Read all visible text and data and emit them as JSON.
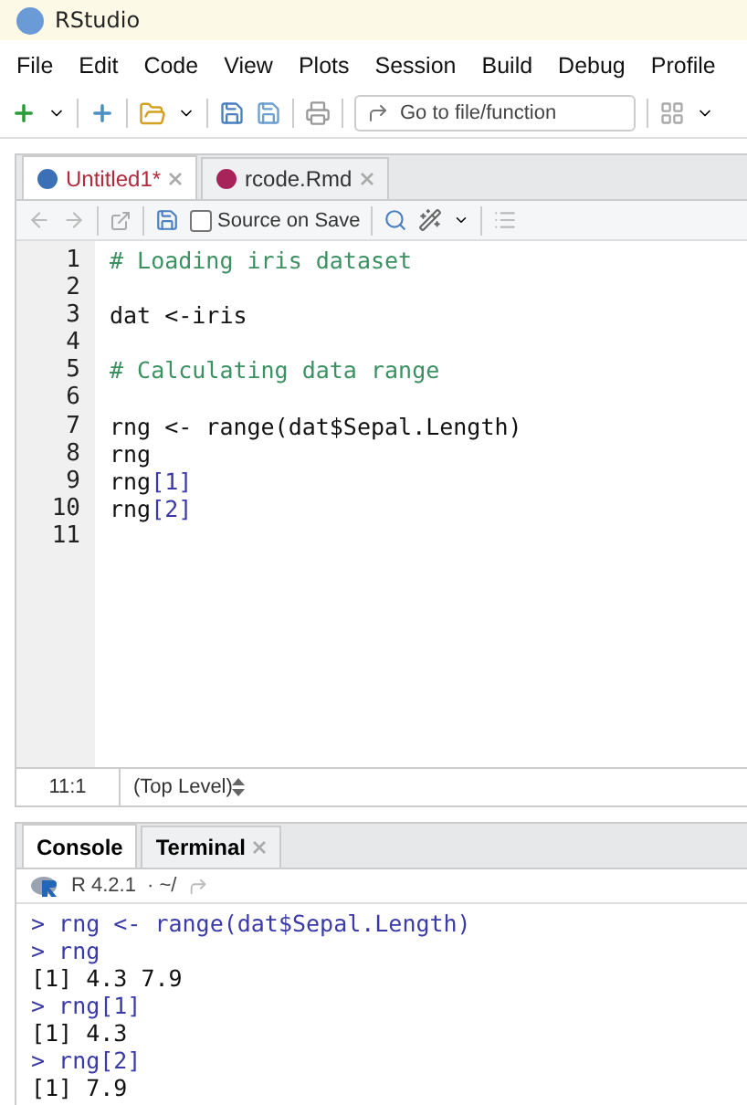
{
  "window": {
    "title": "RStudio"
  },
  "menu": [
    "File",
    "Edit",
    "Code",
    "View",
    "Plots",
    "Session",
    "Build",
    "Debug",
    "Profile"
  ],
  "toolbar": {
    "goto_placeholder": "Go to file/function"
  },
  "editor_tabs": [
    {
      "label": "Untitled1*",
      "kind": "r",
      "selected": true,
      "modified": true
    },
    {
      "label": "rcode.Rmd",
      "kind": "rmd",
      "selected": false,
      "modified": false
    }
  ],
  "editor_toolbar": {
    "source_on_save": {
      "label": "Source on Save",
      "checked": false
    }
  },
  "code_lines": [
    {
      "number": "1",
      "segments": [
        {
          "kind": "comment",
          "text": "# Loading iris dataset"
        }
      ]
    },
    {
      "number": "2"
    },
    {
      "number": "3",
      "segments": [
        {
          "kind": "plain",
          "text": "dat <-iris"
        }
      ]
    },
    {
      "number": "4"
    },
    {
      "number": "5",
      "segments": [
        {
          "kind": "comment",
          "text": "# Calculating data range"
        }
      ]
    },
    {
      "number": "6"
    },
    {
      "number": "7",
      "segments": [
        {
          "kind": "plain",
          "text": "rng <- range(dat$Sepal.Length)"
        }
      ]
    },
    {
      "number": "8",
      "segments": [
        {
          "kind": "plain",
          "text": "rng"
        }
      ]
    },
    {
      "number": "9",
      "segments": [
        {
          "kind": "plain",
          "text": "rng"
        },
        {
          "kind": "number",
          "text": "[1]"
        }
      ]
    },
    {
      "number": "10",
      "segments": [
        {
          "kind": "plain",
          "text": "rng"
        },
        {
          "kind": "number",
          "text": "[2]"
        }
      ]
    },
    {
      "number": "11"
    }
  ],
  "status_bar": {
    "position": "11:1",
    "scope": "(Top Level)"
  },
  "console_tabs": [
    {
      "label": "Console",
      "selected": true,
      "closable": false
    },
    {
      "label": "Terminal",
      "selected": false,
      "closable": true
    }
  ],
  "console_header": {
    "version": "R 4.2.1",
    "path": "· ~/"
  },
  "console_lines": [
    {
      "kind": "input",
      "text": "> rng <- range(dat$Sepal.Length)"
    },
    {
      "kind": "input",
      "text": "> rng"
    },
    {
      "kind": "output",
      "text": "[1] 4.3 7.9"
    },
    {
      "kind": "input",
      "text": "> rng[1]"
    },
    {
      "kind": "output",
      "text": "[1] 4.3"
    },
    {
      "kind": "input",
      "text": "> rng[2]"
    },
    {
      "kind": "output",
      "text": "[1] 7.9"
    }
  ]
}
